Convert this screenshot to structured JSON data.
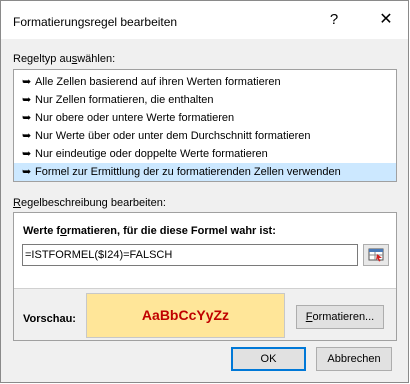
{
  "window": {
    "title": "Formatierungsregel bearbeiten",
    "help_glyph": "?",
    "close_glyph": "✕"
  },
  "ruletype": {
    "label_pre": "Regeltyp au",
    "label_accel": "s",
    "label_post": "wählen:",
    "items": [
      {
        "label": "Alle Zellen basierend auf ihren Werten formatieren",
        "selected": false
      },
      {
        "label": "Nur Zellen formatieren, die enthalten",
        "selected": false
      },
      {
        "label": "Nur obere oder untere Werte formatieren",
        "selected": false
      },
      {
        "label": "Nur Werte über oder unter dem Durchschnitt formatieren",
        "selected": false
      },
      {
        "label": "Nur eindeutige oder doppelte Werte formatieren",
        "selected": false
      },
      {
        "label": "Formel zur Ermittlung der zu formatierenden Zellen verwenden",
        "selected": true
      }
    ],
    "bullet_glyph": "➥"
  },
  "description": {
    "label_pre": "",
    "label_accel": "R",
    "label_post": "egelbeschreibung bearbeiten:",
    "formula_label_pre": "Werte f",
    "formula_label_accel": "o",
    "formula_label_post": "rmatieren, für die diese Formel wahr ist:",
    "formula_value": "=ISTFORMEL($I24)=FALSCH",
    "preview_label": "Vorschau:",
    "preview_text": "AaBbCcYyZz",
    "format_button_accel": "F",
    "format_button_post": "ormatieren..."
  },
  "buttons": {
    "ok": "OK",
    "cancel": "Abbrechen"
  },
  "colors": {
    "selection": "#cce8ff",
    "preview_fill": "#ffe699",
    "preview_text": "#c00000",
    "default_button_border": "#0078d7"
  }
}
